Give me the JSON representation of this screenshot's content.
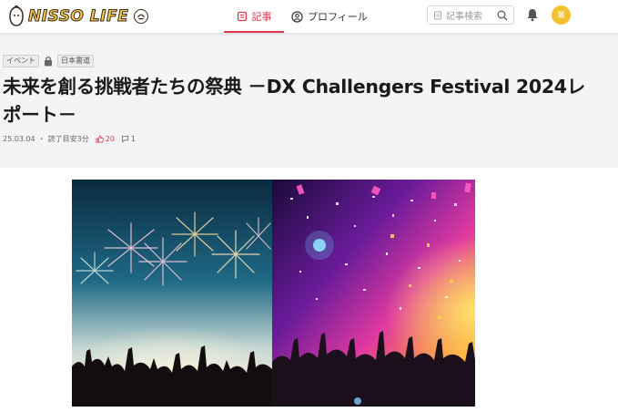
{
  "header": {
    "logo_text": "NISSO LIFE",
    "nav": [
      {
        "label": "記事",
        "icon": "article-icon",
        "active": true
      },
      {
        "label": "プロフィール",
        "icon": "user-icon",
        "active": false
      }
    ],
    "search_placeholder": "記事検索",
    "avatar_initial": "鷲"
  },
  "article": {
    "tags": [
      "イベント",
      "日本書道"
    ],
    "title": "未来を創る挑戦者たちの祭典 －DX Challengers Festival 2024レポート－",
    "date": "25.03.04",
    "separator": "・",
    "read_time": "読了目安3分",
    "likes": "20",
    "comments": "1"
  },
  "colors": {
    "accent": "#e0364f",
    "logo_yellow": "#f7c948",
    "hero_bg": "#f3f4f6",
    "avatar_bg": "#f2c230"
  }
}
